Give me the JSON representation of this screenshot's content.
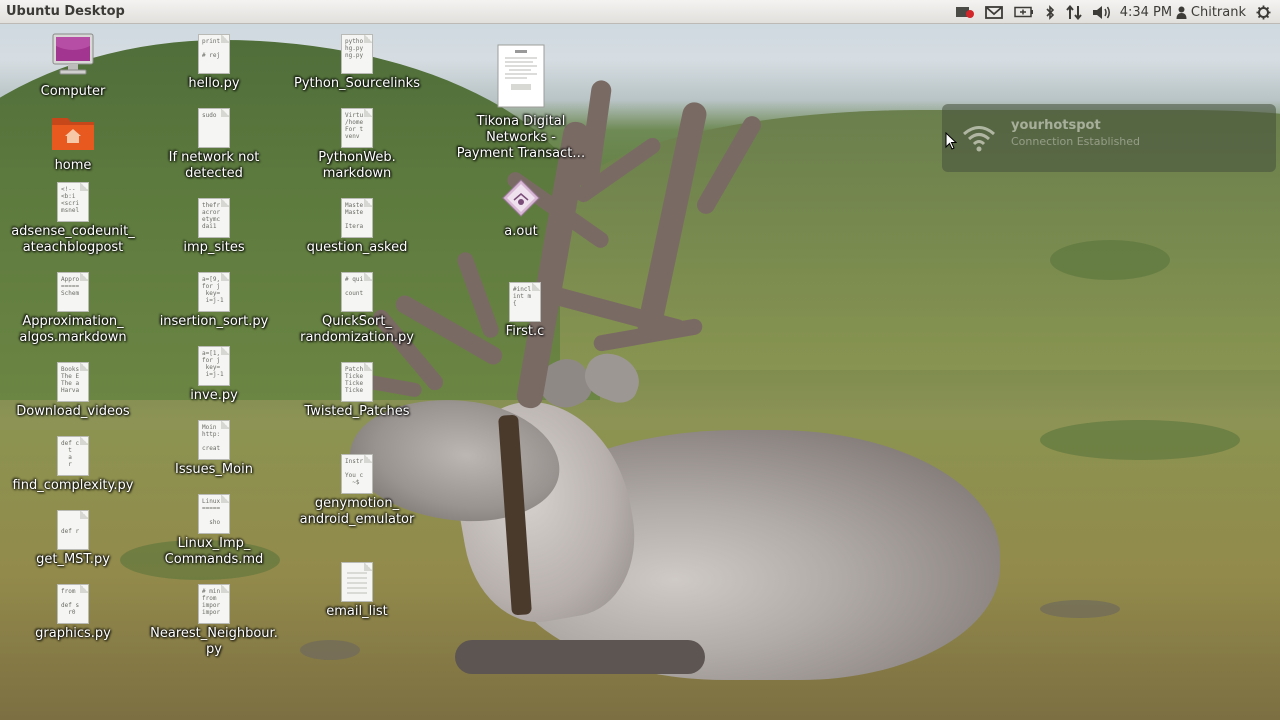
{
  "panel": {
    "title": "Ubuntu Desktop",
    "time": "4:34 PM",
    "user": "Chitrank"
  },
  "notification": {
    "title": "yourhotspot",
    "body": "Connection Established"
  },
  "icons": [
    {
      "label": "Computer",
      "kind": "computer"
    },
    {
      "label": "home",
      "kind": "home"
    },
    {
      "label": "adsense_codeunit_\nateachblogpost",
      "kind": "text",
      "preview": "<!--\n<b:i\n<scri\nmsnel"
    },
    {
      "label": "Approximation_\nalgos.markdown",
      "kind": "text",
      "preview": "Appro\n=====\nSchem"
    },
    {
      "label": "Download_videos",
      "kind": "text",
      "preview": "Books\nThe E\nThe a\nHarva"
    },
    {
      "label": "find_complexity.py",
      "kind": "text",
      "preview": "def c\n  t\n  a\n  r"
    },
    {
      "label": "get_MST.py",
      "kind": "text",
      "preview": "\n\ndef r"
    },
    {
      "label": "graphics.py",
      "kind": "text",
      "preview": "from\n\ndef s\n  r0"
    },
    {
      "label": "hello.py",
      "kind": "text",
      "preview": "print\n\n# rej"
    },
    {
      "label": "If network not\ndetected",
      "kind": "text",
      "preview": "sudo"
    },
    {
      "label": "imp_sites",
      "kind": "text",
      "preview": "thefr\nacror\netymc\ndai1"
    },
    {
      "label": "insertion_sort.py",
      "kind": "text",
      "preview": "a=[9,\nfor j\n key=\n i=j-1"
    },
    {
      "label": "inve.py",
      "kind": "text",
      "preview": "a=[1,\nfor j\n key=\n i=j-1"
    },
    {
      "label": "Issues_Moin",
      "kind": "text",
      "preview": "Moin\nhttp:\n\ncreat"
    },
    {
      "label": "Linux_Imp_\nCommands.md",
      "kind": "text",
      "preview": "Linux\n=====\n\n  sho"
    },
    {
      "label": "Nearest_Neighbour.\npy",
      "kind": "text",
      "preview": "# min\nfrom\nimpor\nimpor"
    },
    {
      "label": "Python_Sourcelinks",
      "kind": "text",
      "preview": "pytho\nhg.py\nng.py"
    },
    {
      "label": "PythonWeb.\nmarkdown",
      "kind": "text",
      "preview": "Virtu\n/home\nFor t\nvenv"
    },
    {
      "label": "question_asked",
      "kind": "text",
      "preview": "Maste\nMaste\n\nItera"
    },
    {
      "label": "QuickSort_\nrandomization.py",
      "kind": "text",
      "preview": "# qui\n\ncount"
    },
    {
      "label": "Twisted_Patches",
      "kind": "text",
      "preview": "Patch\nTicke\nTicke\nTicke"
    },
    {
      "label": "genymotion_\nandroid_emulator",
      "kind": "text",
      "preview": "Instr\n\nYou c\n  ~$"
    },
    {
      "label": "email_list",
      "kind": "text",
      "preview": ""
    },
    {
      "label": "Tikona Digital\nNetworks -\nPayment Transact…",
      "kind": "document"
    },
    {
      "label": "a.out",
      "kind": "executable"
    },
    {
      "label": "First.c",
      "kind": "text",
      "preview": "#incl\nint m\n{"
    }
  ],
  "colors": {
    "panel_bg": "#e2e0dd",
    "panel_text": "#3c3b37",
    "label_text": "#ffffff",
    "home_orange": "#e8591f",
    "computer_screen": "#a2358f",
    "notification_bg": "#46503c"
  },
  "icon_names": {
    "indicators": [
      "recording-icon",
      "mail-icon",
      "battery-icon",
      "bluetooth-icon",
      "network-icon",
      "volume-icon",
      "user-icon",
      "power-gear-icon"
    ],
    "notification": "wifi-icon"
  }
}
